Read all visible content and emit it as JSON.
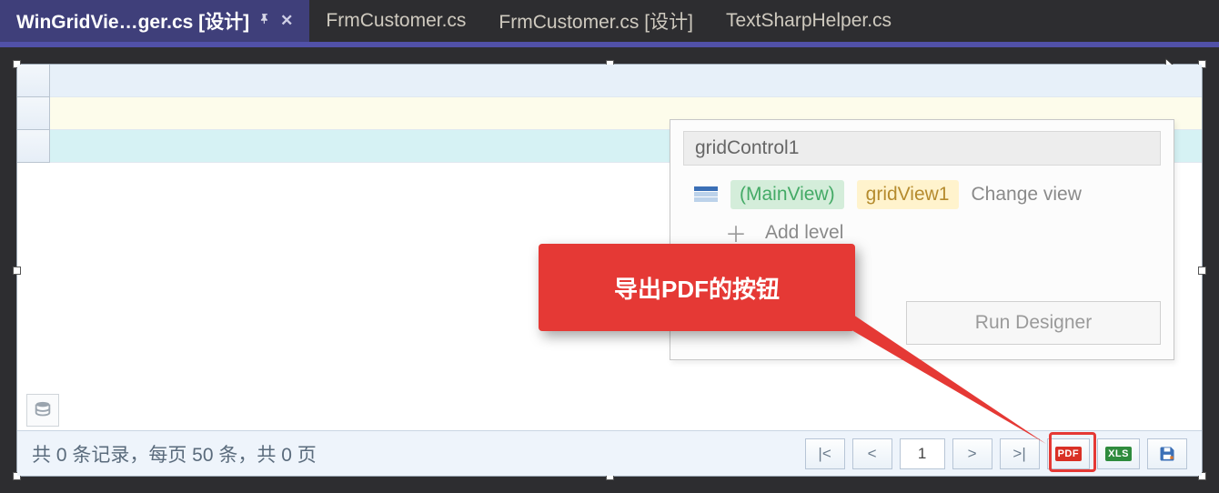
{
  "tabs": [
    {
      "label": "WinGridVie…ger.cs [设计]",
      "active": true,
      "pinned": true
    },
    {
      "label": "FrmCustomer.cs",
      "active": false
    },
    {
      "label": "FrmCustomer.cs [设计]",
      "active": false
    },
    {
      "label": "TextSharpHelper.cs",
      "active": false
    }
  ],
  "smart_panel": {
    "title": "gridControl1",
    "main_view": "(MainView)",
    "view_name": "gridView1",
    "change_view": "Change view",
    "add_level": "Add level",
    "run_designer": "Run Designer"
  },
  "callout": {
    "text": "导出PDF的按钮"
  },
  "pager": {
    "info": "共 0 条记录，每页 50 条，共 0 页",
    "first": "|<",
    "prev": "<",
    "page": "1",
    "next": ">",
    "last": ">|",
    "pdf": "PDF",
    "xls": "XLS"
  }
}
